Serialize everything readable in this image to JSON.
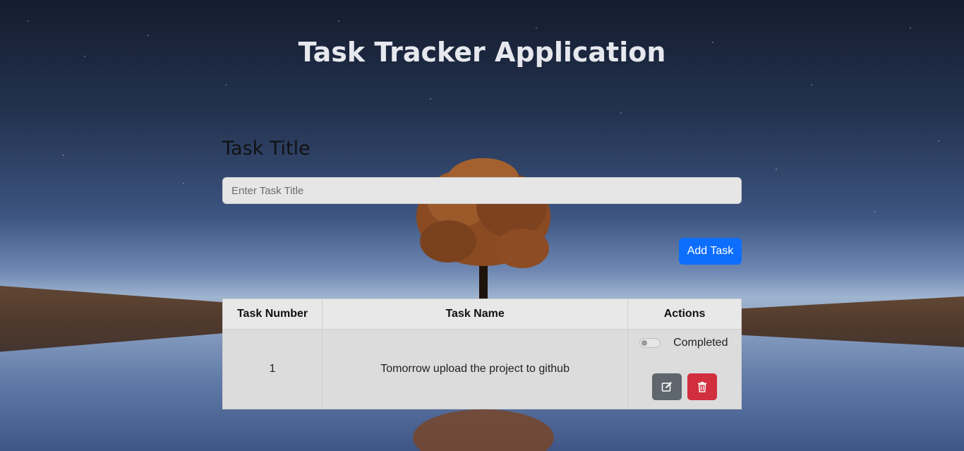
{
  "app": {
    "title": "Task Tracker Application"
  },
  "form": {
    "label": "Task Title",
    "input_placeholder": "Enter Task Title",
    "input_value": "",
    "add_button": "Add Task"
  },
  "table": {
    "headers": [
      "Task Number",
      "Task Name",
      "Actions"
    ],
    "rows": [
      {
        "number": "1",
        "name": "Tomorrow upload the project to github",
        "status_label": "Completed",
        "completed": false
      }
    ]
  },
  "colors": {
    "primary": "#0d6efd",
    "danger": "#d22f3e",
    "secondary": "#5f666d"
  },
  "icons": {
    "edit": "edit-icon",
    "delete": "trash-icon"
  }
}
